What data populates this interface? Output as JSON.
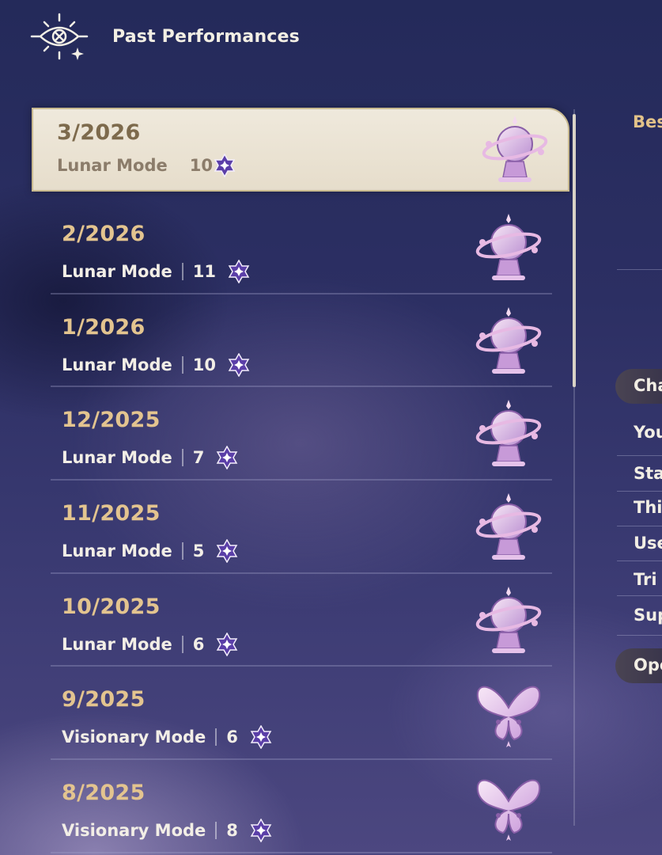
{
  "header": {
    "title": "Past Performances",
    "icon": "eye-sun-icon"
  },
  "records": [
    {
      "date": "3/2026",
      "mode": "Lunar Mode",
      "stars": "10",
      "emblem": "orb-emblem-icon",
      "selected": true
    },
    {
      "date": "2/2026",
      "mode": "Lunar Mode",
      "stars": "11",
      "emblem": "orb-emblem-icon"
    },
    {
      "date": "1/2026",
      "mode": "Lunar Mode",
      "stars": "10",
      "emblem": "orb-emblem-icon"
    },
    {
      "date": "12/2025",
      "mode": "Lunar Mode",
      "stars": "7",
      "emblem": "orb-emblem-icon"
    },
    {
      "date": "11/2025",
      "mode": "Lunar Mode",
      "stars": "5",
      "emblem": "orb-emblem-icon"
    },
    {
      "date": "10/2025",
      "mode": "Lunar Mode",
      "stars": "6",
      "emblem": "orb-emblem-icon"
    },
    {
      "date": "9/2025",
      "mode": "Visionary Mode",
      "stars": "6",
      "emblem": "butterfly-emblem-icon"
    },
    {
      "date": "8/2025",
      "mode": "Visionary Mode",
      "stars": "8",
      "emblem": "butterfly-emblem-icon"
    }
  ],
  "right_panel": {
    "best_label": "Bes",
    "tab1": "Cha",
    "items": [
      "You",
      "Sta",
      "Thi",
      "Use",
      "Tri",
      "Sup"
    ],
    "tab2": "Ope"
  },
  "colors": {
    "gold": "#e3c48f",
    "selected_bg": "#efe9dc",
    "star_fill": "#5b3fa8"
  }
}
